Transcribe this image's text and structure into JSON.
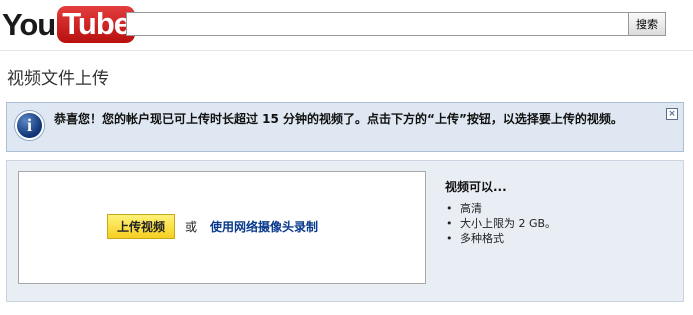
{
  "header": {
    "logo_you": "You",
    "logo_tube": "Tube",
    "search_value": "",
    "search_button": "搜索"
  },
  "page": {
    "title": "视频文件上传"
  },
  "alert": {
    "message": "恭喜您！您的帐户现已可上传时长超过 15 分钟的视频了。点击下方的“上传”按钮，以选择要上传的视频。",
    "close_glyph": "×"
  },
  "upload": {
    "button_label": "上传视频",
    "or_label": "或",
    "webcam_link": "使用网络摄像头录制"
  },
  "features": {
    "title": "视频可以...",
    "items": [
      "高清",
      "大小上限为 2 GB。",
      "多种格式"
    ]
  },
  "colors": {
    "link": "#0a3a8c",
    "alert_bg": "#dfe8f2",
    "upload_button": "#f6cf20"
  }
}
